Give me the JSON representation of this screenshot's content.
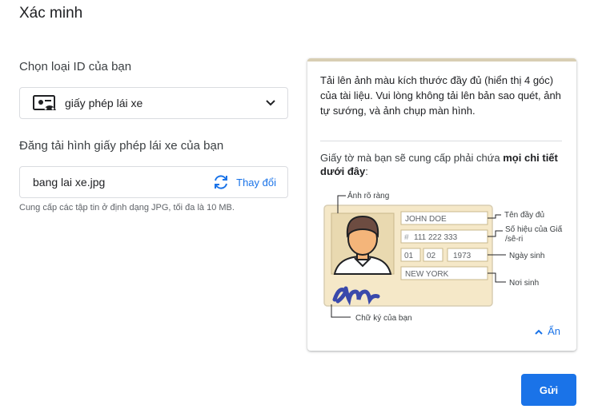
{
  "page": {
    "title": "Xác minh"
  },
  "id_type": {
    "label": "Chọn loại ID của bạn",
    "selected": "giấy phép lái xe",
    "icon": "id-card-icon"
  },
  "upload": {
    "label": "Đăng tải hình giấy phép lái xe của bạn",
    "file_name": "bang lai xe.jpg",
    "change_label": "Thay đổi",
    "hint": "Cung cấp các tập tin ở định dạng JPG, tối đa là 10 MB."
  },
  "info": {
    "instructions": "Tải lên ảnh màu kích thước đầy đủ (hiển thị 4 góc) của tài liệu. Vui lòng không tải lên bản sao quét, ảnh tự sướng, và ảnh chụp màn hình.",
    "requirements_prefix": "Giấy tờ mà bạn sẽ cung cấp phải chứa ",
    "requirements_bold": "mọi chi tiết dưới đây",
    "requirements_suffix": ":",
    "illustration": {
      "callout_photo": "Ảnh rõ ràng",
      "callout_name": "Tên đầy đủ",
      "callout_number_line1": "Số hiệu của Giấ",
      "callout_number_line2": "/sê-ri",
      "callout_dob": "Ngày sinh",
      "callout_pob": "Nơi sinh",
      "callout_signature": "Chữ ký của bạn",
      "field_name": "JOHN DOE",
      "field_number": "111 222 333",
      "field_number_prefix": "#",
      "field_day": "01",
      "field_month": "02",
      "field_year": "1973",
      "field_place": "NEW YORK"
    },
    "collapse_label": "Ẩn"
  },
  "actions": {
    "submit_label": "Gửi"
  },
  "colors": {
    "accent": "#1a73e8",
    "card_beige": "#f5e8c8",
    "card_border": "#d8ceb3"
  }
}
